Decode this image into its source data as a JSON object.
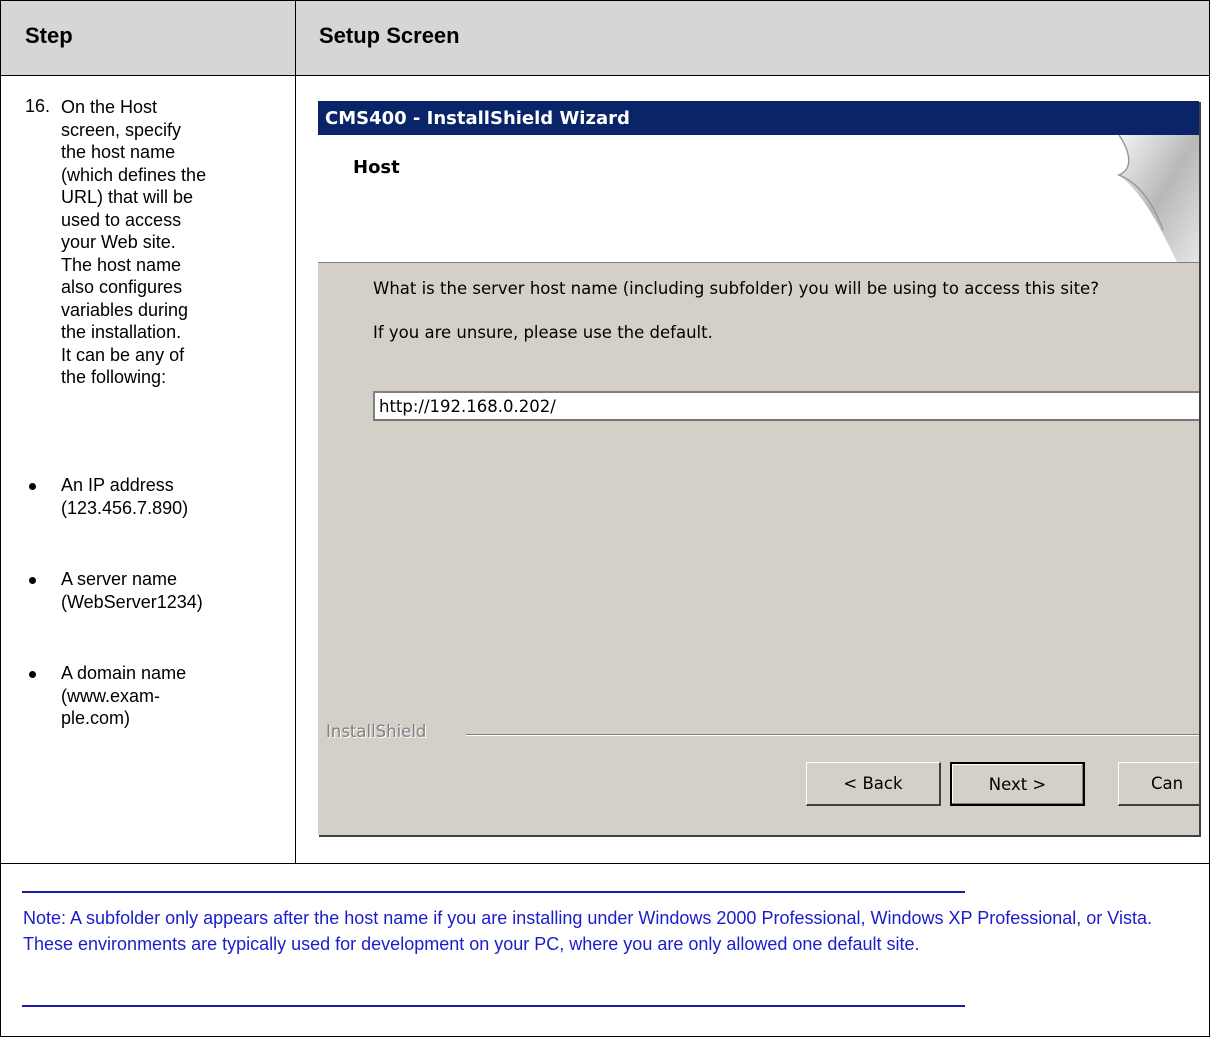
{
  "table": {
    "header_step": "Step",
    "header_screen": "Setup Screen"
  },
  "step": {
    "number": "16.",
    "lines": [
      "On the Host",
      "screen, specify",
      "the host name",
      "(which defines the",
      "URL) that will be",
      "used to access",
      "your Web site.",
      "The host name",
      "also configures",
      "variables during",
      "the installation.",
      "It can be any of",
      "the following:"
    ],
    "bullets": [
      {
        "line1": "An IP address",
        "line2": "(123.456.7.890)"
      },
      {
        "line1": "A server name",
        "line2": "(WebServer1234)"
      },
      {
        "line1": "A domain name",
        "line2": "(www.exam-",
        "line3": "ple.com)"
      }
    ]
  },
  "wizard": {
    "title": "CMS400 - InstallShield Wizard",
    "page_title": "Host",
    "prompt": "What is the server host name (including subfolder) you will be using to access this site?",
    "hint": "If you are unsure, please use the default.",
    "host_value": "http://192.168.0.202/",
    "brand": "InstallShield",
    "back_label": "< Back",
    "next_label": "Next >",
    "cancel_label": "Can"
  },
  "note": {
    "text": "Note: A subfolder only appears after the host name if you are installing under Windows 2000 Professional, Windows XP Professional, or Vista. These environments are typically used for development on your PC, where you are only allowed one default site."
  }
}
